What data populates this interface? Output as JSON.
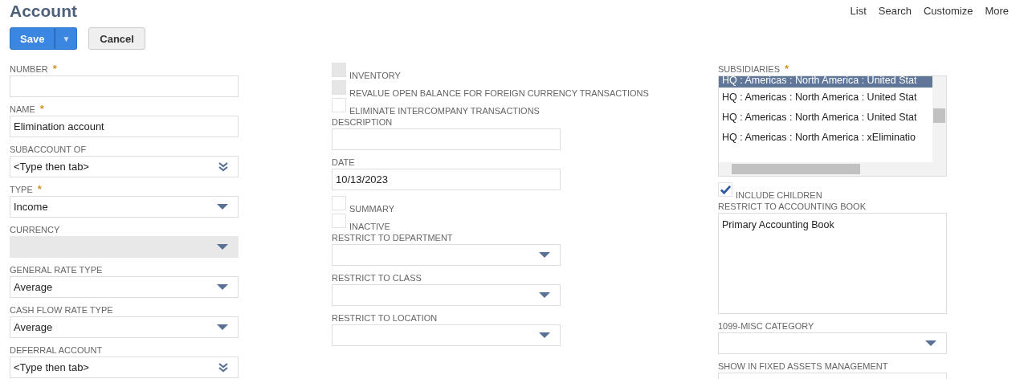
{
  "page_title": "Account",
  "nav_links": [
    "List",
    "Search",
    "Customize",
    "More"
  ],
  "buttons": [
    {
      "label": "Save",
      "kind": "primary",
      "menu_arrow": "▼"
    },
    {
      "label": "Cancel",
      "kind": "secondary"
    }
  ],
  "columns": [
    [
      {
        "kind": "text",
        "label": "NUMBER",
        "required_mark": "*"
      },
      {
        "kind": "text",
        "label": "NAME",
        "required_mark": "*",
        "value": "Elimination account"
      },
      {
        "kind": "lookup",
        "label": "SUBACCOUNT OF",
        "value": "<Type then tab>"
      },
      {
        "kind": "select",
        "label": "TYPE",
        "required_mark": "*",
        "value": "Income",
        "disabled": false
      },
      {
        "kind": "select",
        "label": "CURRENCY",
        "disabled": true
      },
      {
        "kind": "select",
        "label": "GENERAL RATE TYPE",
        "value": "Average",
        "disabled": false
      },
      {
        "kind": "select",
        "label": "CASH FLOW RATE TYPE",
        "value": "Average",
        "disabled": false
      },
      {
        "kind": "lookup",
        "label": "DEFERRAL ACCOUNT",
        "value": "<Type then tab>"
      }
    ],
    [
      {
        "kind": "checkbox",
        "label": "INVENTORY",
        "checked": false,
        "disabled": true
      },
      {
        "kind": "checkbox",
        "label": "REVALUE OPEN BALANCE FOR FOREIGN CURRENCY TRANSACTIONS",
        "checked": false,
        "disabled": true
      },
      {
        "kind": "checkbox",
        "label": "ELIMINATE INTERCOMPANY TRANSACTIONS",
        "checked": false,
        "disabled": false
      },
      {
        "kind": "text",
        "label": "DESCRIPTION"
      },
      {
        "kind": "text",
        "label": "DATE",
        "value": "10/13/2023"
      },
      {
        "kind": "checkbox",
        "label": "SUMMARY",
        "checked": false,
        "disabled": false
      },
      {
        "kind": "checkbox",
        "label": "INACTIVE",
        "checked": false,
        "disabled": false
      },
      {
        "kind": "select",
        "label": "RESTRICT TO DEPARTMENT",
        "disabled": false
      },
      {
        "kind": "select",
        "label": "RESTRICT TO CLASS",
        "disabled": false
      },
      {
        "kind": "select",
        "label": "RESTRICT TO LOCATION",
        "disabled": false
      }
    ],
    [
      {
        "kind": "multiselect",
        "label": "SUBSIDIARIES",
        "required_mark": "*",
        "options": [
          {
            "label": "HQ : Americas : North America : United Stat",
            "selected": true
          },
          {
            "label": "HQ : Americas : North America : United Stat",
            "selected": false
          },
          {
            "label": "HQ : Americas : North America : United Stat",
            "selected": false
          },
          {
            "label": "HQ : Americas : North America : xEliminatio",
            "selected": false
          }
        ]
      },
      {
        "kind": "checkbox",
        "label": "INCLUDE CHILDREN",
        "checked": true,
        "disabled": false
      },
      {
        "kind": "list",
        "label": "RESTRICT TO ACCOUNTING BOOK",
        "options": [
          {
            "label": "Primary Accounting Book",
            "selected": false
          }
        ]
      },
      {
        "kind": "select",
        "label": "1099-MISC CATEGORY",
        "disabled": false
      },
      {
        "kind": "text",
        "label": "SHOW IN FIXED ASSETS MANAGEMENT"
      }
    ]
  ]
}
